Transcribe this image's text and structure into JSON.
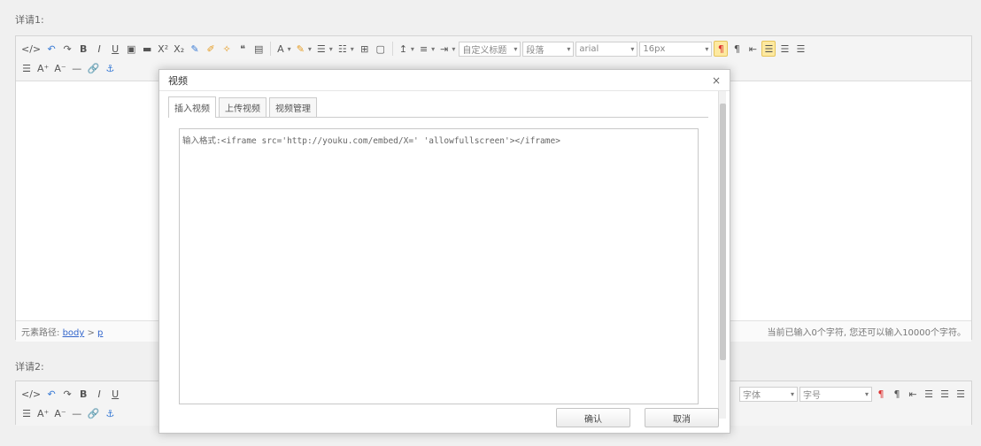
{
  "fields": {
    "label1": "详请1:",
    "label2": "详请2:"
  },
  "toolbar_main": {
    "combos": [
      {
        "label": "自定义标题"
      },
      {
        "label": "段落"
      },
      {
        "label": "arial"
      },
      {
        "label": "16px"
      }
    ]
  },
  "toolbar_secondary": {
    "combos": [
      {
        "label": "字体"
      },
      {
        "label": "字号"
      }
    ]
  },
  "statusbar": {
    "path_prefix": "元素路径:",
    "path_body": "body",
    "path_sep": " > ",
    "path_p": "p",
    "wordcount": "当前已输入0个字符, 您还可以输入10000个字符。"
  },
  "dialog": {
    "title": "视频",
    "close": "×",
    "tabs": [
      "插入视频",
      "上传视频",
      "视频管理"
    ],
    "placeholder": "输入格式:<iframe src='http://youku.com/embed/X=' 'allowfullscreen'></iframe>",
    "confirm": "确认",
    "cancel": "取消"
  }
}
